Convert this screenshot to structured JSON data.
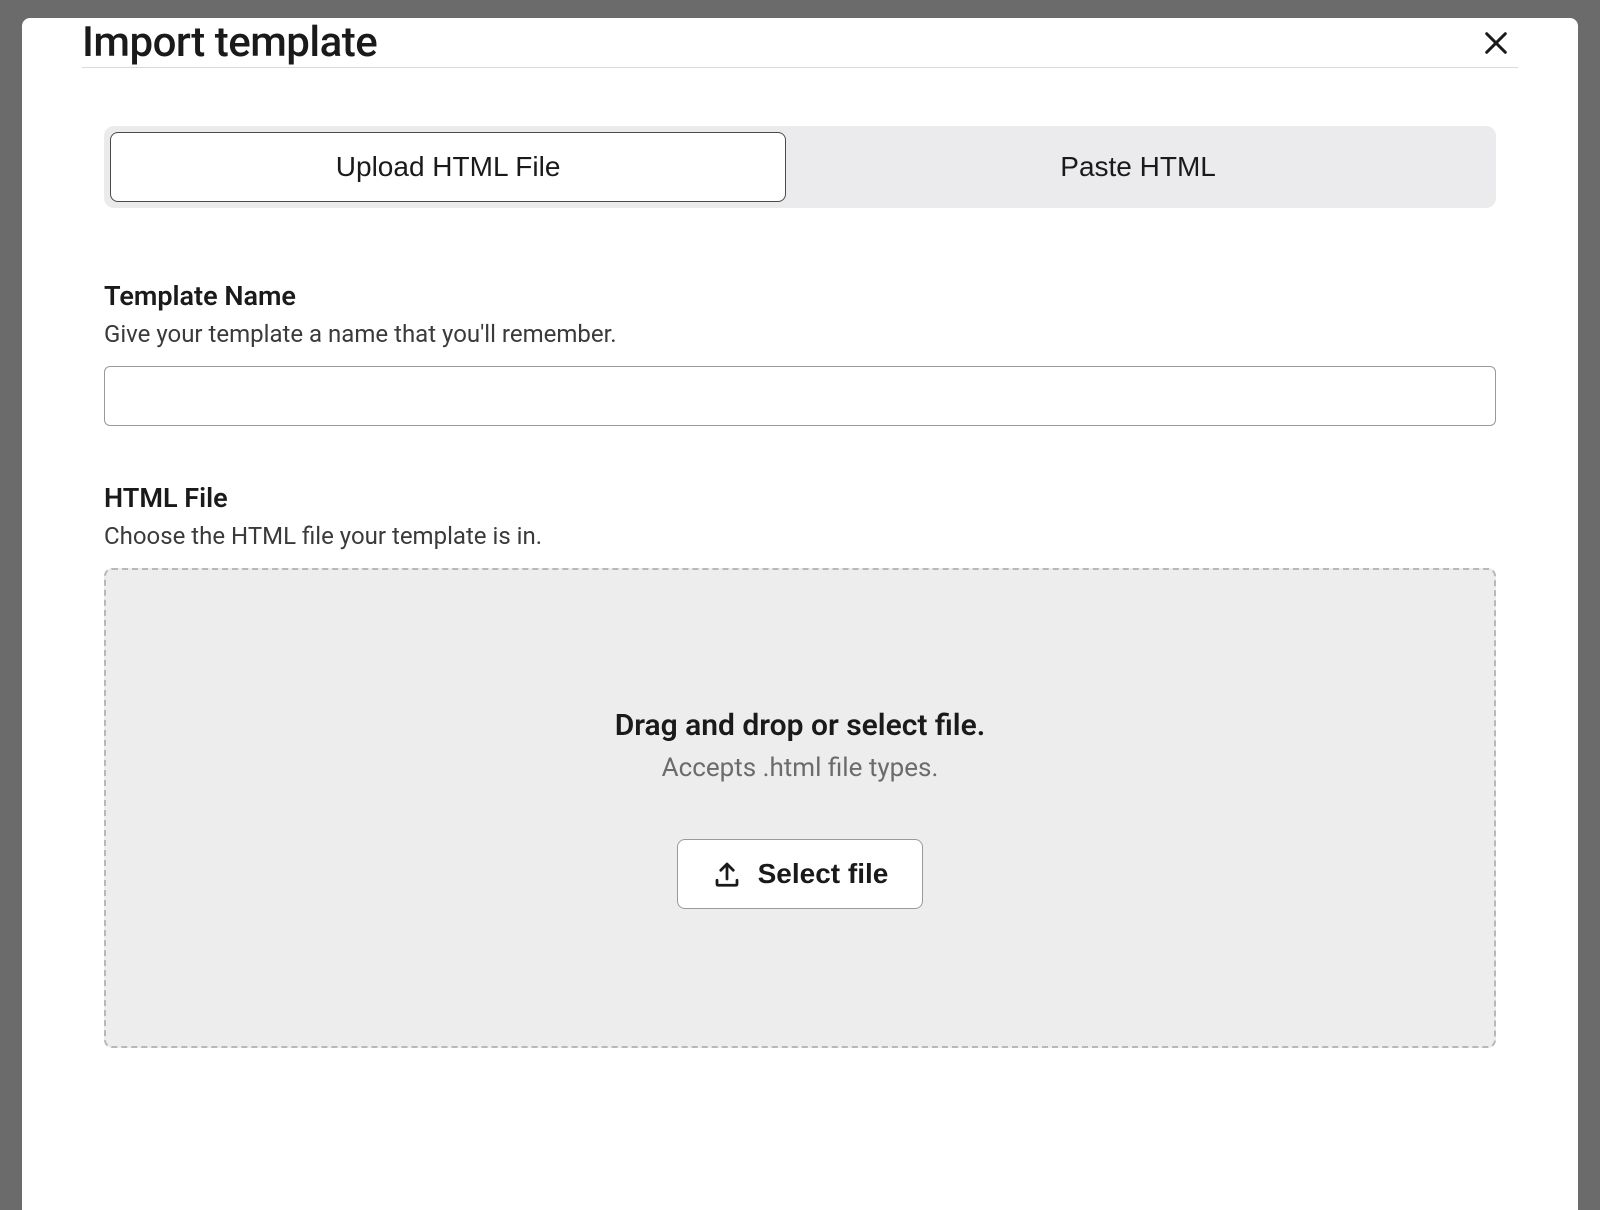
{
  "modal": {
    "title": "Import template",
    "tabs": {
      "upload": "Upload HTML File",
      "paste": "Paste HTML"
    },
    "template_name": {
      "label": "Template Name",
      "help": "Give your template a name that you'll remember.",
      "value": ""
    },
    "html_file": {
      "label": "HTML File",
      "help": "Choose the HTML file your template is in.",
      "dropzone_title": "Drag and drop or select file.",
      "dropzone_subtitle": "Accepts .html file types.",
      "select_button": "Select file"
    }
  }
}
